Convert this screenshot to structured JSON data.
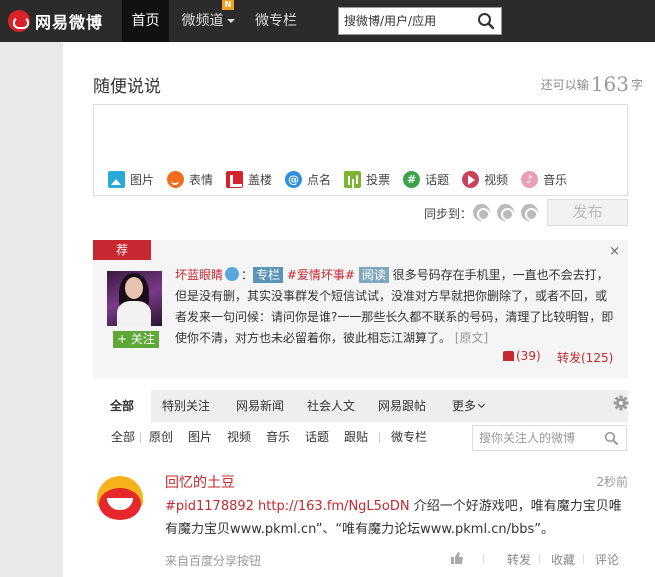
{
  "nav": {
    "logo_text": "网易微博",
    "home": "首页",
    "channel": "微频道",
    "new_badge": "N",
    "column": "微专栏",
    "search_placeholder": "搜微博/用户/应用"
  },
  "publisher": {
    "title": "随便说说",
    "remain_prefix": "还可以输",
    "remain_count": "163",
    "remain_suffix": "字",
    "tools": [
      "图片",
      "表情",
      "盖楼",
      "点名",
      "投票",
      "话题",
      "视频",
      "音乐"
    ],
    "sync_label": "同步到：",
    "publish": "发布"
  },
  "recommend": {
    "tag": "荐",
    "close": "×",
    "follow": "关注",
    "name": "坏蓝眼睛",
    "colon": "：",
    "chip_column": "专栏",
    "topic": "#爱情坏事#",
    "chip_read": "阅读",
    "text": "很多号码存在手机里，一直也不会去打，但是没有删，其实没事群发个短信试试，没准对方早就把你删除了，或者不回，或者发来一句问候：请问你是谁?一一那些长久都不联系的号码，清理了比较明智，即使你不清，对方也未必留着你，彼此相忘江湖算了。",
    "orig": "[原文]",
    "likes": "(39)",
    "forward": "转发(125)"
  },
  "tabs": {
    "items": [
      "全部",
      "特别关注",
      "网易新闻",
      "社会人文",
      "网易跟帖",
      "更多"
    ]
  },
  "filters": {
    "items": [
      "全部",
      "原创",
      "图片",
      "视频",
      "音乐",
      "话题",
      "跟贴",
      "微专栏"
    ],
    "search_placeholder": "搜你关注人的微博"
  },
  "feed": {
    "name": "回忆的土豆",
    "time": "2秒前",
    "tag": "#pid1178892",
    "link": "http://163.fm/NgL5oDN",
    "text": " 介绍一个好游戏吧，唯有魔力宝贝唯有魔力宝贝www.pkml.cn”、“唯有魔力论坛www.pkml.cn/bbs”。",
    "source": "来自百度分享按钮",
    "actions": [
      "转发",
      "收藏",
      "评论"
    ]
  },
  "colors": {
    "topbar": "#2b2b2b",
    "accent_red": "#c6282f",
    "follow_green": "#5da839"
  }
}
